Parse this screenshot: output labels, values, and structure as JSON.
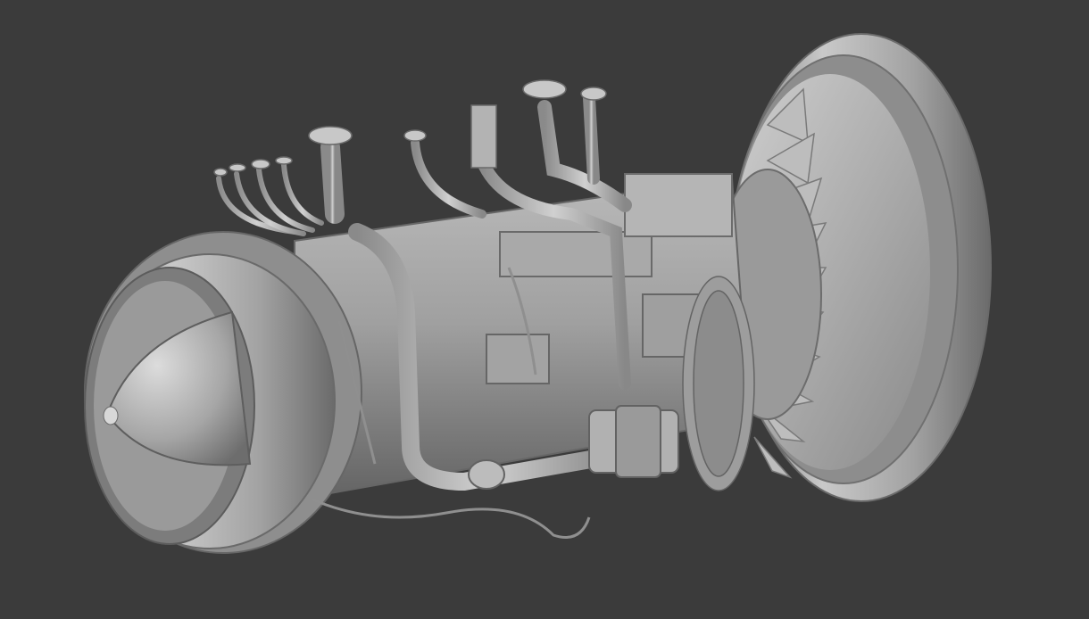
{
  "viewport": {
    "background_color": "#3b3b3b",
    "model_color": "#a8a8a8",
    "model_highlight": "#d6d6d6",
    "model_shadow": "#5e5e5e",
    "shading": "matcap-clay-grey"
  },
  "model": {
    "components": [
      "fan-casing",
      "fan-blades",
      "combustion-core",
      "exhaust-nozzle",
      "exhaust-cone",
      "fuel-pipes",
      "accessory-gearbox",
      "mounting-brackets",
      "cable-harness"
    ]
  }
}
